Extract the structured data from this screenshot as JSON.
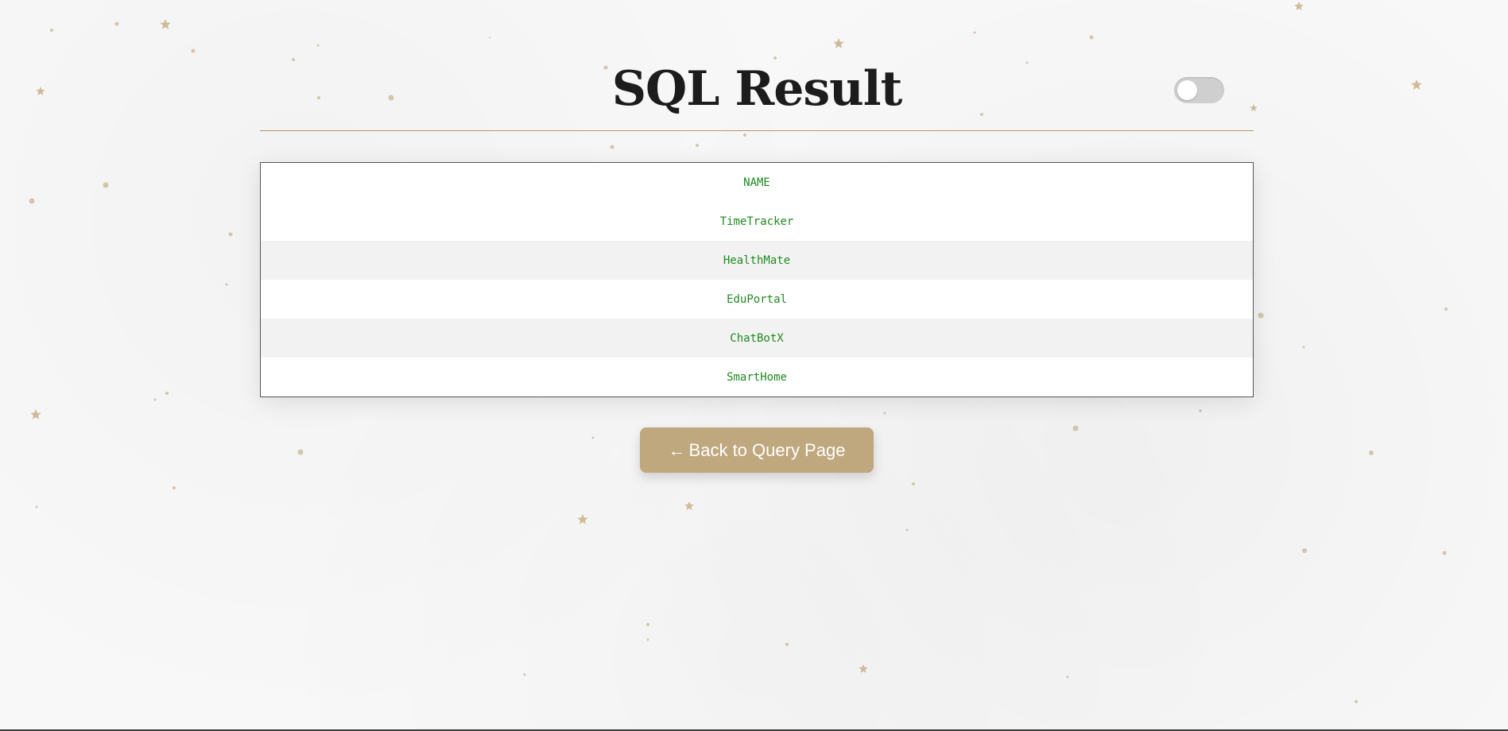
{
  "header": {
    "title": "SQL Result"
  },
  "theme_toggle": {
    "state": "off"
  },
  "result": {
    "columns": [
      "NAME"
    ],
    "rows": [
      [
        "TimeTracker"
      ],
      [
        "HealthMate"
      ],
      [
        "EduPortal"
      ],
      [
        "ChatBotX"
      ],
      [
        "SmartHome"
      ]
    ]
  },
  "actions": {
    "back_arrow": "←",
    "back_label": "Back to Query Page"
  },
  "colors": {
    "accent": "#bfa77e",
    "rule": "#b8976a",
    "cell_text": "#1f8a1f",
    "sparkle": "#c8b08a"
  },
  "icons": {
    "theme_toggle": "toggle-switch-icon",
    "back": "left-arrow-icon",
    "decor": "star-sparkle-icon"
  }
}
